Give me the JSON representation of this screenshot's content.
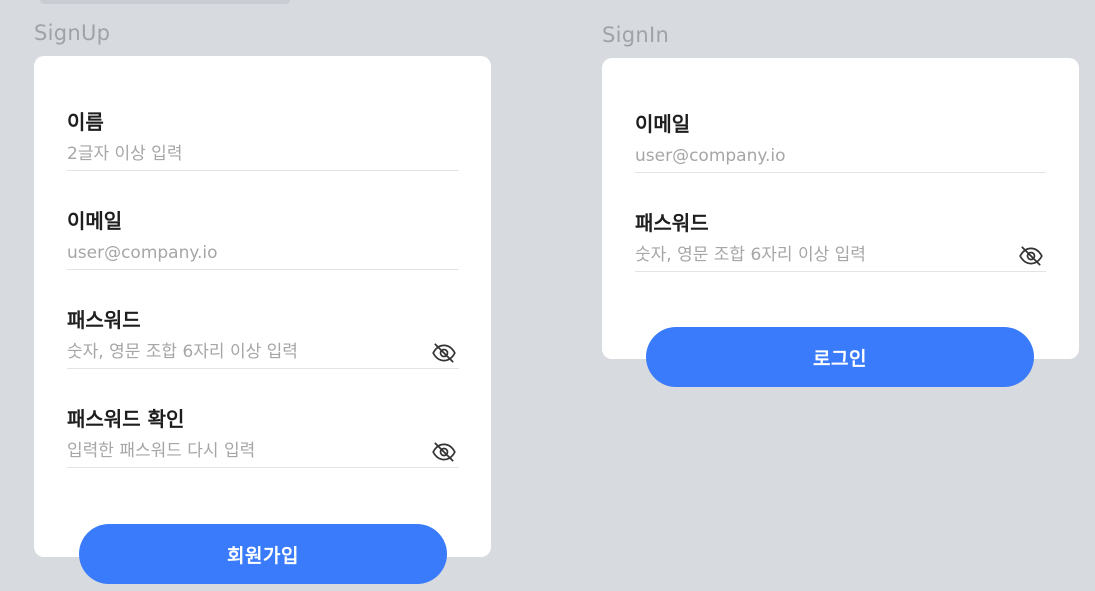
{
  "signup": {
    "title": "SignUp",
    "fields": {
      "name": {
        "label": "이름",
        "placeholder": "2글자 이상 입력"
      },
      "email": {
        "label": "이메일",
        "placeholder": "user@company.io"
      },
      "password": {
        "label": "패스워드",
        "placeholder": "숫자, 영문 조합 6자리 이상 입력"
      },
      "password_confirm": {
        "label": "패스워드 확인",
        "placeholder": "입력한 패스워드 다시 입력"
      }
    },
    "submit_label": "회원가입"
  },
  "signin": {
    "title": "SignIn",
    "fields": {
      "email": {
        "label": "이메일",
        "placeholder": "user@company.io"
      },
      "password": {
        "label": "패스워드",
        "placeholder": "숫자, 영문 조합 6자리 이상 입력"
      }
    },
    "submit_label": "로그인"
  },
  "icons": {
    "password_toggle": "eye-off-icon"
  },
  "colors": {
    "background": "#d7dadf",
    "card": "#ffffff",
    "primary": "#3a7bfb",
    "label": "#1e1e1e",
    "placeholder": "#a6a6a6",
    "frame_title": "#9ea3a9"
  }
}
